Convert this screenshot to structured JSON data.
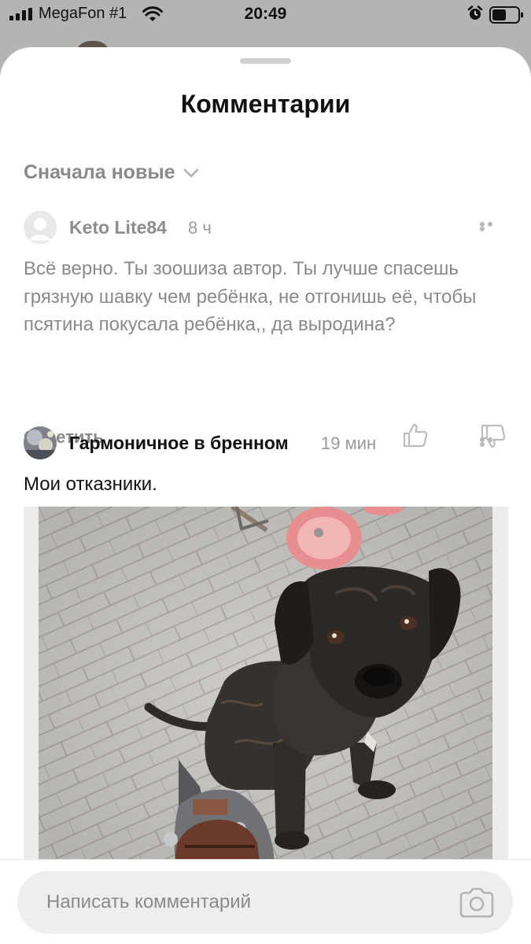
{
  "status": {
    "carrier": "MegaFon #1",
    "time": "20:49"
  },
  "sheet": {
    "title": "Комментарии",
    "sort_label": "Сначала новые"
  },
  "comments": [
    {
      "author": "Keto Lite84",
      "time": "8 ч",
      "text": "Всё верно. Ты зоошиза автор. Ты  лучше спасешь  грязную шавку чем ребёнка, не отгонишь её, чтобы псятина покусала ребёнка,, да выродина?",
      "reply_label": "Ответить"
    },
    {
      "author": "Гармоничное в бренном",
      "time": "19 мин",
      "text": "Мои отказники."
    }
  ],
  "composer": {
    "placeholder": "Написать комментарий"
  },
  "colors": {
    "sheet_bg": "#ffffff",
    "backdrop": "#b4b4b4",
    "muted_text": "#8a8a8a",
    "input_bg": "#eeeeee"
  }
}
